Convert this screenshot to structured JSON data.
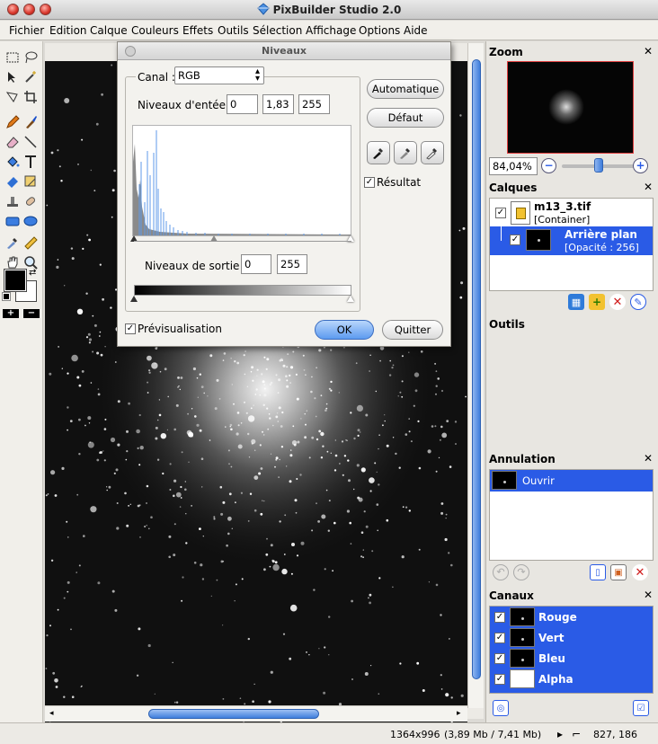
{
  "window": {
    "title": "PixBuilder Studio 2.0"
  },
  "menu": [
    "Fichier",
    "Edition",
    "Calque",
    "Couleurs",
    "Effets",
    "Outils",
    "Sélection",
    "Affichage",
    "Options",
    "Aide"
  ],
  "dialog": {
    "title": "Niveaux",
    "canal_label": "Canal :",
    "canal_value": "RGB",
    "input_levels_label": "Niveaux d'entée :",
    "input_levels": [
      "0",
      "1,83",
      "255"
    ],
    "output_levels_label": "Niveaux de sortie :",
    "output_levels": [
      "0",
      "255"
    ],
    "btn_auto": "Automatique",
    "btn_default": "Défaut",
    "result_label": "Résultat",
    "result_checked": true,
    "preview_label": "Prévisualisation",
    "preview_checked": true,
    "btn_ok": "OK",
    "btn_quit": "Quitter"
  },
  "zoom": {
    "title": "Zoom",
    "value": "84,04%",
    "slider_fraction": 0.5
  },
  "layers": {
    "title": "Calques",
    "items": [
      {
        "name": "m13_3.tif",
        "sub": "[Container]",
        "checked": true
      },
      {
        "name": "Arrière plan",
        "sub": "[Opacité : 256]",
        "checked": true,
        "selected": true
      }
    ]
  },
  "tools_panel": {
    "title": "Outils"
  },
  "history": {
    "title": "Annulation",
    "items": [
      {
        "label": "Ouvrir",
        "selected": true
      }
    ]
  },
  "channels": {
    "title": "Canaux",
    "items": [
      {
        "label": "Rouge",
        "checked": true
      },
      {
        "label": "Vert",
        "checked": true
      },
      {
        "label": "Bleu",
        "checked": true
      },
      {
        "label": "Alpha",
        "checked": true
      }
    ]
  },
  "status": {
    "dimensions": "1364x996",
    "size": "(3,89 Mb / 7,41 Mb)",
    "coords": "827, 186"
  },
  "colors": {
    "accent": "#2a5be6",
    "selection": "#2a5be6"
  }
}
